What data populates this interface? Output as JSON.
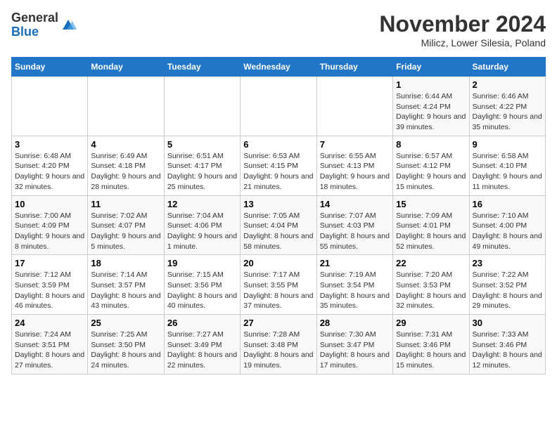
{
  "header": {
    "logo_general": "General",
    "logo_blue": "Blue",
    "month_title": "November 2024",
    "subtitle": "Milicz, Lower Silesia, Poland"
  },
  "days_of_week": [
    "Sunday",
    "Monday",
    "Tuesday",
    "Wednesday",
    "Thursday",
    "Friday",
    "Saturday"
  ],
  "weeks": [
    [
      {
        "day": "",
        "detail": ""
      },
      {
        "day": "",
        "detail": ""
      },
      {
        "day": "",
        "detail": ""
      },
      {
        "day": "",
        "detail": ""
      },
      {
        "day": "",
        "detail": ""
      },
      {
        "day": "1",
        "detail": "Sunrise: 6:44 AM\nSunset: 4:24 PM\nDaylight: 9 hours and 39 minutes."
      },
      {
        "day": "2",
        "detail": "Sunrise: 6:46 AM\nSunset: 4:22 PM\nDaylight: 9 hours and 35 minutes."
      }
    ],
    [
      {
        "day": "3",
        "detail": "Sunrise: 6:48 AM\nSunset: 4:20 PM\nDaylight: 9 hours and 32 minutes."
      },
      {
        "day": "4",
        "detail": "Sunrise: 6:49 AM\nSunset: 4:18 PM\nDaylight: 9 hours and 28 minutes."
      },
      {
        "day": "5",
        "detail": "Sunrise: 6:51 AM\nSunset: 4:17 PM\nDaylight: 9 hours and 25 minutes."
      },
      {
        "day": "6",
        "detail": "Sunrise: 6:53 AM\nSunset: 4:15 PM\nDaylight: 9 hours and 21 minutes."
      },
      {
        "day": "7",
        "detail": "Sunrise: 6:55 AM\nSunset: 4:13 PM\nDaylight: 9 hours and 18 minutes."
      },
      {
        "day": "8",
        "detail": "Sunrise: 6:57 AM\nSunset: 4:12 PM\nDaylight: 9 hours and 15 minutes."
      },
      {
        "day": "9",
        "detail": "Sunrise: 6:58 AM\nSunset: 4:10 PM\nDaylight: 9 hours and 11 minutes."
      }
    ],
    [
      {
        "day": "10",
        "detail": "Sunrise: 7:00 AM\nSunset: 4:09 PM\nDaylight: 9 hours and 8 minutes."
      },
      {
        "day": "11",
        "detail": "Sunrise: 7:02 AM\nSunset: 4:07 PM\nDaylight: 9 hours and 5 minutes."
      },
      {
        "day": "12",
        "detail": "Sunrise: 7:04 AM\nSunset: 4:06 PM\nDaylight: 9 hours and 1 minute."
      },
      {
        "day": "13",
        "detail": "Sunrise: 7:05 AM\nSunset: 4:04 PM\nDaylight: 8 hours and 58 minutes."
      },
      {
        "day": "14",
        "detail": "Sunrise: 7:07 AM\nSunset: 4:03 PM\nDaylight: 8 hours and 55 minutes."
      },
      {
        "day": "15",
        "detail": "Sunrise: 7:09 AM\nSunset: 4:01 PM\nDaylight: 8 hours and 52 minutes."
      },
      {
        "day": "16",
        "detail": "Sunrise: 7:10 AM\nSunset: 4:00 PM\nDaylight: 8 hours and 49 minutes."
      }
    ],
    [
      {
        "day": "17",
        "detail": "Sunrise: 7:12 AM\nSunset: 3:59 PM\nDaylight: 8 hours and 46 minutes."
      },
      {
        "day": "18",
        "detail": "Sunrise: 7:14 AM\nSunset: 3:57 PM\nDaylight: 8 hours and 43 minutes."
      },
      {
        "day": "19",
        "detail": "Sunrise: 7:15 AM\nSunset: 3:56 PM\nDaylight: 8 hours and 40 minutes."
      },
      {
        "day": "20",
        "detail": "Sunrise: 7:17 AM\nSunset: 3:55 PM\nDaylight: 8 hours and 37 minutes."
      },
      {
        "day": "21",
        "detail": "Sunrise: 7:19 AM\nSunset: 3:54 PM\nDaylight: 8 hours and 35 minutes."
      },
      {
        "day": "22",
        "detail": "Sunrise: 7:20 AM\nSunset: 3:53 PM\nDaylight: 8 hours and 32 minutes."
      },
      {
        "day": "23",
        "detail": "Sunrise: 7:22 AM\nSunset: 3:52 PM\nDaylight: 8 hours and 29 minutes."
      }
    ],
    [
      {
        "day": "24",
        "detail": "Sunrise: 7:24 AM\nSunset: 3:51 PM\nDaylight: 8 hours and 27 minutes."
      },
      {
        "day": "25",
        "detail": "Sunrise: 7:25 AM\nSunset: 3:50 PM\nDaylight: 8 hours and 24 minutes."
      },
      {
        "day": "26",
        "detail": "Sunrise: 7:27 AM\nSunset: 3:49 PM\nDaylight: 8 hours and 22 minutes."
      },
      {
        "day": "27",
        "detail": "Sunrise: 7:28 AM\nSunset: 3:48 PM\nDaylight: 8 hours and 19 minutes."
      },
      {
        "day": "28",
        "detail": "Sunrise: 7:30 AM\nSunset: 3:47 PM\nDaylight: 8 hours and 17 minutes."
      },
      {
        "day": "29",
        "detail": "Sunrise: 7:31 AM\nSunset: 3:46 PM\nDaylight: 8 hours and 15 minutes."
      },
      {
        "day": "30",
        "detail": "Sunrise: 7:33 AM\nSunset: 3:46 PM\nDaylight: 8 hours and 12 minutes."
      }
    ]
  ]
}
